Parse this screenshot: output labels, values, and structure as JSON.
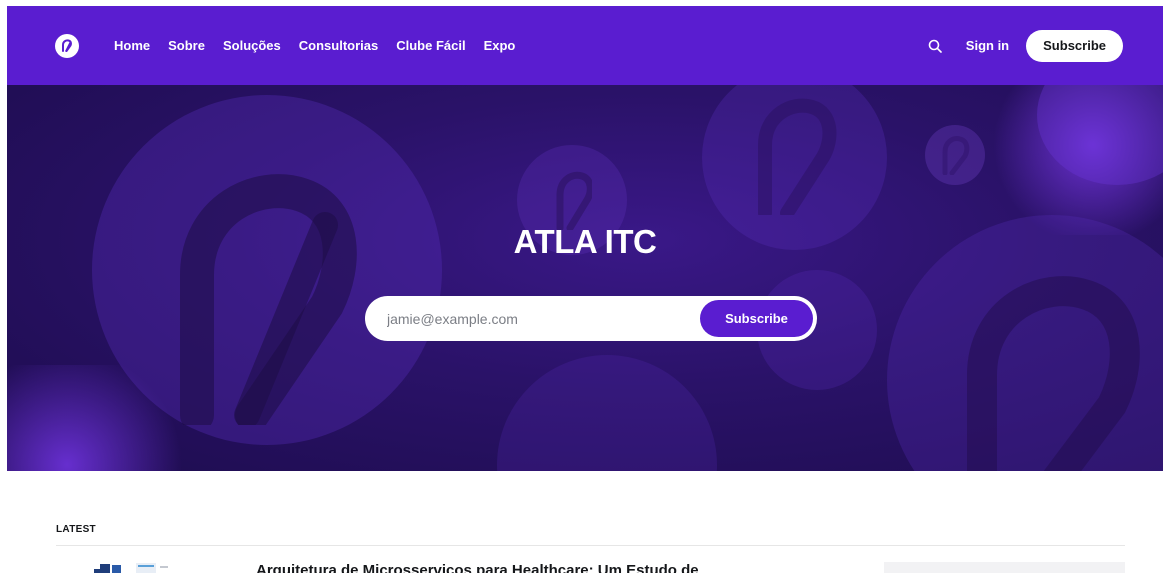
{
  "brand": {
    "accent_color": "#5a1dd0",
    "logo_icon": "atla-logo-icon"
  },
  "nav": {
    "links": [
      {
        "label": "Home"
      },
      {
        "label": "Sobre"
      },
      {
        "label": "Soluções"
      },
      {
        "label": "Consultorias"
      },
      {
        "label": "Clube Fácil"
      },
      {
        "label": "Expo"
      }
    ],
    "search_icon": "search-icon",
    "signin_label": "Sign in",
    "subscribe_label": "Subscribe"
  },
  "hero": {
    "title": "ATLA ITC",
    "email_placeholder": "jamie@example.com",
    "subscribe_label": "Subscribe"
  },
  "latest": {
    "label": "LATEST",
    "first_article_title": "Arquitetura de Microsserviços para Healthcare: Um Estudo de"
  }
}
